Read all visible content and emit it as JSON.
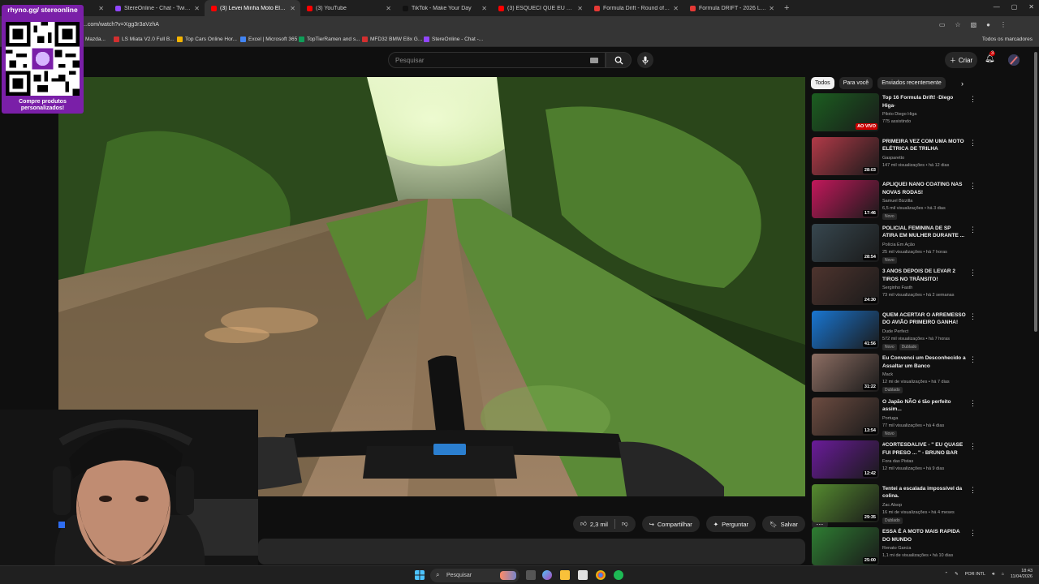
{
  "browser": {
    "tabs": [
      {
        "title": "",
        "color": "#444444"
      },
      {
        "title": "StereOnline - Chat - Twitch",
        "color": "#9146ff"
      },
      {
        "title": "(3) Levei Minha Moto Elétri",
        "color": "#ff0000"
      },
      {
        "title": "(3) YouTube",
        "color": "#ff0000"
      },
      {
        "title": "TikTok - Make Your Day",
        "color": "#111111"
      },
      {
        "title": "(3) ESQUECI QUE EU TENHO U",
        "color": "#ff0000"
      },
      {
        "title": "Formula Drift - Round of 16",
        "color": "#e53935"
      },
      {
        "title": "Formula DRIFT - 2026 Long Be",
        "color": "#e53935"
      }
    ],
    "url": "...com/watch?v=Xgg3r3aVzhA",
    "bookmarks": [
      {
        "label": "Mazda...",
        "color": "#888888"
      },
      {
        "label": "LS Miata V2.0 Full B...",
        "color": "#d32f2f"
      },
      {
        "label": "Top Cars Online Hor...",
        "color": "#f4b400"
      },
      {
        "label": "Excel | Microsoft 365",
        "color": "#4285f4"
      },
      {
        "label": "TopTierRamen and s...",
        "color": "#0f9d58"
      },
      {
        "label": "MFD32 BMW E8x G...",
        "color": "#d32f2f"
      },
      {
        "label": "StereOnline - Chat -...",
        "color": "#9146ff"
      }
    ],
    "bookmarks_right": "Todos os marcadores"
  },
  "overlay": {
    "handle": "rhyno.gg/ stereonline",
    "promo": "Compre produtos personalizados!"
  },
  "youtube": {
    "search_placeholder": "Pesquisar",
    "create_label": "Criar",
    "notif_count": "3",
    "actions": {
      "likes": "2,3 mil",
      "share": "Compartilhar",
      "ask": "Perguntar",
      "save": "Salvar"
    },
    "chips": [
      "Todos",
      "Para você",
      "Enviados recentemente"
    ],
    "recommendations": [
      {
        "title": "Top 16 Formula Drift! ·Diego Higa·",
        "channel": "Piloto Diego Higa",
        "meta": "775 assistindo",
        "duration": "AO VIVO",
        "live": true,
        "badges": [],
        "thumb": "#1b5e20"
      },
      {
        "title": "PRIMEIRA VEZ COM UMA MOTO ELÉTRICA DE TRILHA",
        "channel": "Gasparetto",
        "meta": "147 mil visualizações • há 12 dias",
        "duration": "28:03",
        "live": false,
        "badges": [],
        "thumb": "#b23a48"
      },
      {
        "title": "APLIQUEI NANO COATING NAS NOVAS RODAS!",
        "channel": "Samuel Bizzilla",
        "meta": "6,5 mil visualizações • há 3 dias",
        "duration": "17:46",
        "live": false,
        "badges": [
          "Novo"
        ],
        "thumb": "#c2185b"
      },
      {
        "title": "POLICIAL FEMININA DE SP ATIRA EM MULHER DURANTE ...",
        "channel": "Polícia Em Ação",
        "meta": "25 mil visualizações • há 7 horas",
        "duration": "28:54",
        "live": false,
        "badges": [
          "Novo"
        ],
        "thumb": "#37474f"
      },
      {
        "title": "3 ANOS DEPOIS DE LEVAR 2 TIROS NO TRÂNSITO!",
        "channel": "Serginho Fasth",
        "meta": "73 mil visualizações • há 2 semanas",
        "duration": "24:30",
        "live": false,
        "badges": [],
        "thumb": "#4e342e"
      },
      {
        "title": "QUEM ACERTAR O ARREMESSO DO AVIÃO PRIMEIRO GANHA!",
        "channel": "Dude Perfect",
        "meta": "572 mil visualizações • há 7 horas",
        "duration": "41:56",
        "live": false,
        "badges": [
          "Novo",
          "Dublado"
        ],
        "thumb": "#1976d2"
      },
      {
        "title": "Eu Convenci um Desconhecido a Assaltar um Banco",
        "channel": "Mack",
        "meta": "12 mi de visualizações • há 7 dias",
        "duration": "31:22",
        "live": false,
        "badges": [
          "Dublado"
        ],
        "thumb": "#8d6e63"
      },
      {
        "title": "O Japão NÃO é tão perfeito assim...",
        "channel": "Portuga",
        "meta": "77 mil visualizações • há 4 dias",
        "duration": "13:54",
        "live": false,
        "badges": [
          "Novo"
        ],
        "thumb": "#6d4c41"
      },
      {
        "title": "#CORTESDALIVE - \" EU QUASE FUI PRESO ... \" - BRUNO BAR",
        "channel": "Fora das Pistas",
        "meta": "12 mil visualizações • há 9 dias",
        "duration": "12:42",
        "live": false,
        "badges": [],
        "thumb": "#6a1b9a"
      },
      {
        "title": "Tentei a escalada impossível da colina.",
        "channel": "Zac Alsop",
        "meta": "16 mi de visualizações • há 4 meses",
        "duration": "29:35",
        "live": false,
        "badges": [
          "Dublado"
        ],
        "thumb": "#558b2f"
      },
      {
        "title": "ESSA É A MOTO MAIS RAPIDA DO MUNDO",
        "channel": "Renato Garcia",
        "meta": "1,1 mi de visualizações • há 10 dias",
        "duration": "25:00",
        "live": false,
        "badges": [],
        "thumb": "#2e7d32"
      }
    ]
  },
  "taskbar": {
    "search": "Pesquisar",
    "lang": "POR INTL",
    "time": "18:43",
    "date": "11/04/2026"
  }
}
